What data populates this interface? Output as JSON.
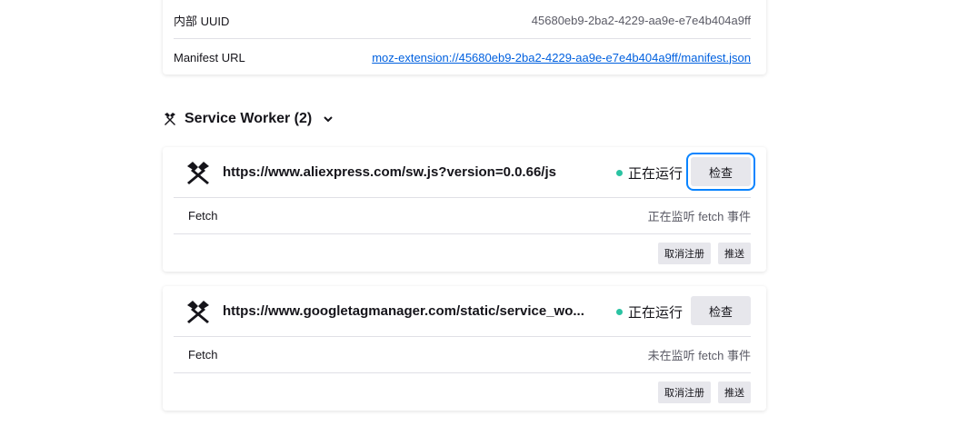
{
  "extension_info": {
    "uuid_label": "内部 UUID",
    "uuid_value": "45680eb9-2ba2-4229-aa9e-e7e4b404a9ff",
    "manifest_label": "Manifest URL",
    "manifest_url": "moz-extension://45680eb9-2ba2-4229-aa9e-e7e4b404a9ff/manifest.json"
  },
  "section": {
    "title": "Service Worker (2)",
    "icon": "service-worker-icon",
    "toggle_icon": "chevron-down-icon"
  },
  "workers": [
    {
      "url": "https://www.aliexpress.com/sw.js?version=0.0.66/js",
      "status": "正在运行",
      "inspect_label": "检查",
      "fetch_label": "Fetch",
      "fetch_status": "正在监听 fetch 事件",
      "unregister_label": "取消注册",
      "push_label": "推送"
    },
    {
      "url": "https://www.googletagmanager.com/static/service_wo...",
      "status": "正在运行",
      "inspect_label": "检查",
      "fetch_label": "Fetch",
      "fetch_status": "未在监听 fetch 事件",
      "unregister_label": "取消注册",
      "push_label": "推送"
    }
  ],
  "colors": {
    "link": "#0060df",
    "status_running": "#2ac3a2",
    "focus_ring": "#0a84ff"
  }
}
